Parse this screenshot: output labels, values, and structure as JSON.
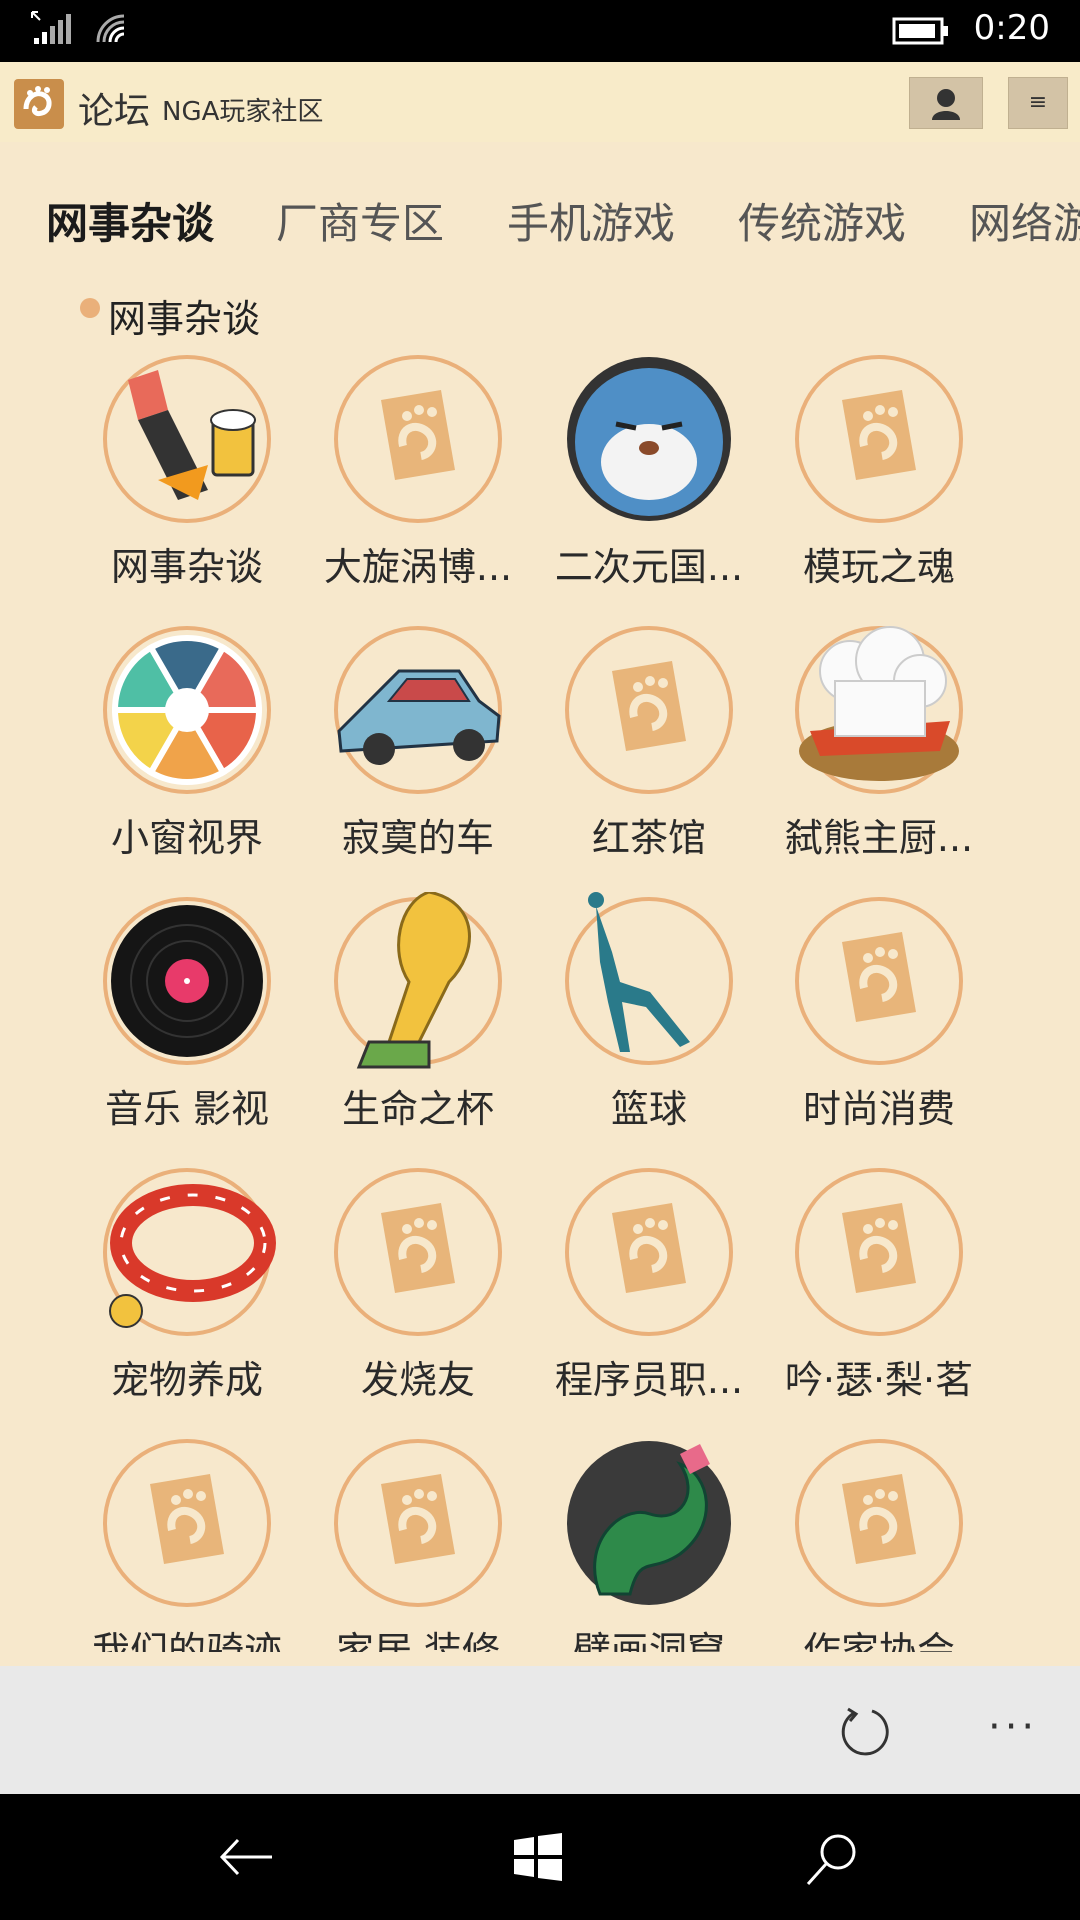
{
  "status": {
    "time": "0:20"
  },
  "header": {
    "title": "论坛",
    "subtitle": "NGA玩家社区",
    "menu_glyph": "≡"
  },
  "tabs": [
    "网事杂谈",
    "厂商专区",
    "手机游戏",
    "传统游戏",
    "网络游"
  ],
  "section": {
    "title": "网事杂谈"
  },
  "forums": [
    {
      "label": "网事杂谈",
      "icon": "beer-mug-hand-icon"
    },
    {
      "label": "大旋涡博...",
      "icon": "nga-paw-placeholder-icon"
    },
    {
      "label": "二次元国...",
      "icon": "blue-cat-icon"
    },
    {
      "label": "模玩之魂",
      "icon": "nga-paw-placeholder-icon"
    },
    {
      "label": "小窗视界",
      "icon": "camera-aperture-icon"
    },
    {
      "label": "寂寞的车",
      "icon": "blue-car-icon"
    },
    {
      "label": "红茶馆",
      "icon": "nga-paw-placeholder-icon"
    },
    {
      "label": "弑熊主厨...",
      "icon": "chef-hat-icon"
    },
    {
      "label": "音乐 影视",
      "icon": "vinyl-record-icon"
    },
    {
      "label": "生命之杯",
      "icon": "world-cup-trophy-icon"
    },
    {
      "label": "篮球",
      "icon": "basketball-dunk-silhouette-icon"
    },
    {
      "label": "时尚消费",
      "icon": "nga-paw-placeholder-icon"
    },
    {
      "label": "宠物养成",
      "icon": "pet-collar-icon"
    },
    {
      "label": "发烧友",
      "icon": "nga-paw-placeholder-icon"
    },
    {
      "label": "程序员职...",
      "icon": "nga-paw-placeholder-icon"
    },
    {
      "label": "吟·瑟·梨·茗",
      "icon": "nga-paw-placeholder-icon"
    },
    {
      "label": "我们的骑迹",
      "icon": "nga-paw-placeholder-icon"
    },
    {
      "label": "家居 装修",
      "icon": "nga-paw-placeholder-icon"
    },
    {
      "label": "壁画洞窟",
      "icon": "green-dragon-icon"
    },
    {
      "label": "作家协会",
      "icon": "nga-paw-placeholder-icon"
    }
  ],
  "colors": {
    "background": "#f7e8cc",
    "placeholder": "#e8b57a",
    "app_bar": "#e9e9e9"
  },
  "app_bar": {
    "refresh_icon": "refresh-icon",
    "more_label": "···"
  }
}
